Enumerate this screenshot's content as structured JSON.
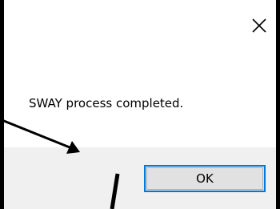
{
  "dialog": {
    "message": "SWAY process completed.",
    "ok_label": "OK",
    "close_icon": "close-icon"
  },
  "colors": {
    "button_focus_border": "#0078d7",
    "footer_background": "#f0f0f0",
    "button_background": "#e1e1e1"
  }
}
